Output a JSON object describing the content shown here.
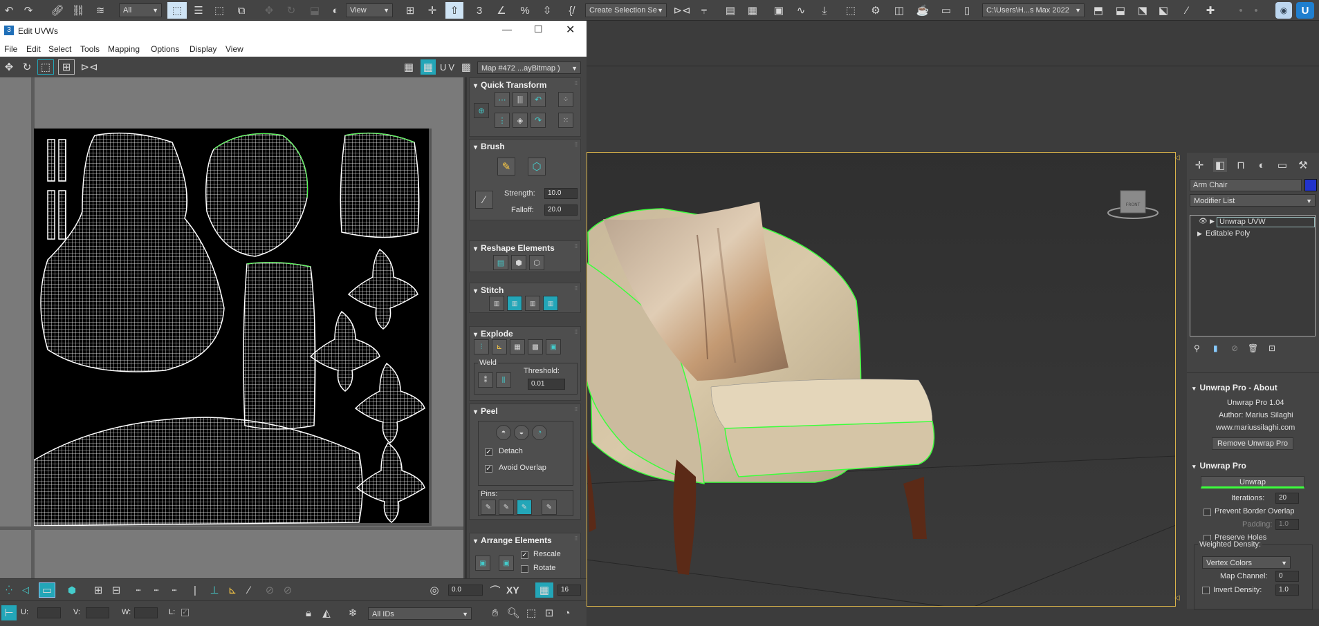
{
  "main_toolbar": {
    "filter_combo": "All",
    "view_combo": "View",
    "selection_set_combo": "Create Selection Se",
    "project_path": "C:\\Users\\H...s Max 2022"
  },
  "uvw_window": {
    "title": "Edit UVWs",
    "menu": [
      "File",
      "Edit",
      "Select",
      "Tools",
      "Mapping",
      "Options",
      "Display",
      "View"
    ],
    "uv_label": "UV",
    "map_combo": "Map #472 ...ayBitmap )",
    "rollouts": {
      "quick_transform": "Quick Transform",
      "brush": "Brush",
      "strength_label": "Strength:",
      "strength_value": "10.0",
      "falloff_label": "Falloff:",
      "falloff_value": "20.0",
      "reshape": "Reshape Elements",
      "stitch": "Stitch",
      "explode": "Explode",
      "weld_label": "Weld",
      "threshold_label": "Threshold:",
      "threshold_value": "0.01",
      "peel": "Peel",
      "detach_label": "Detach",
      "avoid_overlap_label": "Avoid Overlap",
      "pins_label": "Pins:",
      "arrange": "Arrange Elements",
      "rescale_label": "Rescale",
      "rotate_label": "Rotate"
    },
    "bottom": {
      "angle_value": "0.0",
      "xy_label": "XY",
      "grid_value": "16",
      "u_label": "U:",
      "v_label": "V:",
      "w_label": "W:",
      "l_label": "L:",
      "ids_combo": "All IDs"
    }
  },
  "command_panel": {
    "object_name": "Arm Chair",
    "object_color": "#2233cc",
    "modifier_list": "Modifier List",
    "stack": [
      "Unwrap UVW",
      "Editable Poly"
    ],
    "about_title": "Unwrap Pro - About",
    "about_version": "Unwrap Pro 1.04",
    "about_author": "Author: Marius Silaghi",
    "about_url": "www.mariussilaghi.com",
    "remove_button": "Remove Unwrap Pro",
    "unwrap_title": "Unwrap Pro",
    "unwrap_button": "Unwrap",
    "iterations_label": "Iterations:",
    "iterations_value": "20",
    "prevent_border_overlap": "Prevent Border Overlap",
    "padding_label": "Padding:",
    "padding_value": "1.0",
    "preserve_holes": "Preserve Holes",
    "weighted_density": "Weighted Density:",
    "vertex_colors": "Vertex Colors",
    "map_channel_label": "Map Channel:",
    "map_channel_value": "0",
    "invert_density": "Invert Density:",
    "invert_value": "1.0"
  },
  "viewport": {
    "cube_label": "FRONT"
  },
  "colors": {
    "accent_teal": "#23a6b8",
    "selection_green": "#3cff3c",
    "viewport_border": "#d9b34a"
  }
}
